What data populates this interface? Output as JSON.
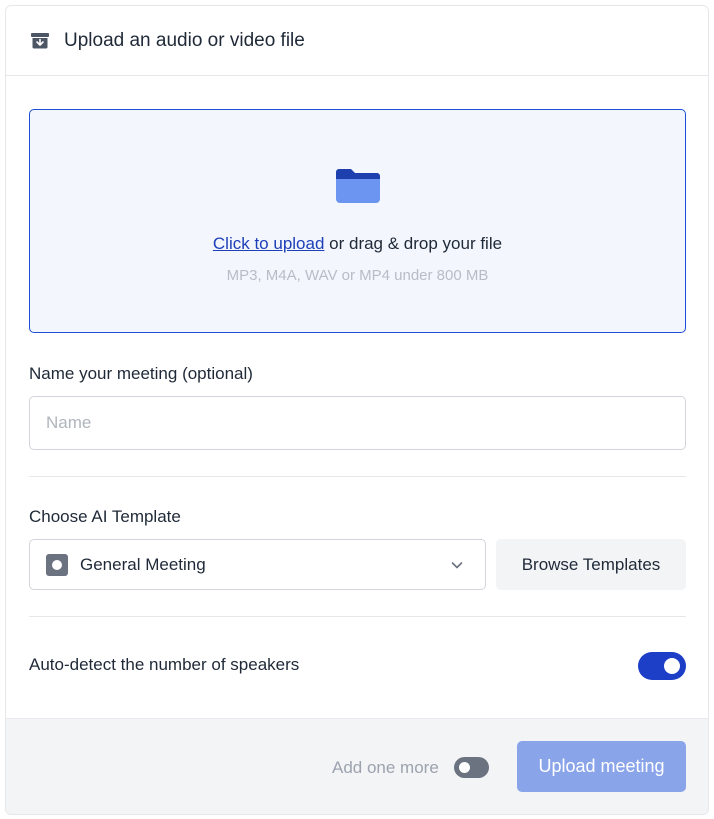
{
  "header": {
    "icon": "archive-box-icon",
    "title": "Upload an audio or video file"
  },
  "dropzone": {
    "icon": "folder-icon",
    "link_text": "Click to upload",
    "rest_text": " or drag & drop your file",
    "hint": "MP3, M4A, WAV or MP4 under 800 MB"
  },
  "meeting_name": {
    "label": "Name your meeting (optional)",
    "placeholder": "Name",
    "value": ""
  },
  "template": {
    "label": "Choose AI Template",
    "icon": "template-icon",
    "selected": "General Meeting",
    "browse_label": "Browse Templates"
  },
  "speakers": {
    "label": "Auto-detect the number of speakers",
    "enabled": true
  },
  "footer": {
    "add_more_label": "Add one more",
    "add_more_enabled": false,
    "upload_label": "Upload meeting"
  },
  "colors": {
    "accent": "#1d3fc7",
    "upload_button_disabled": "#8aa4ea",
    "dropzone_bg": "#f3f6fd"
  }
}
